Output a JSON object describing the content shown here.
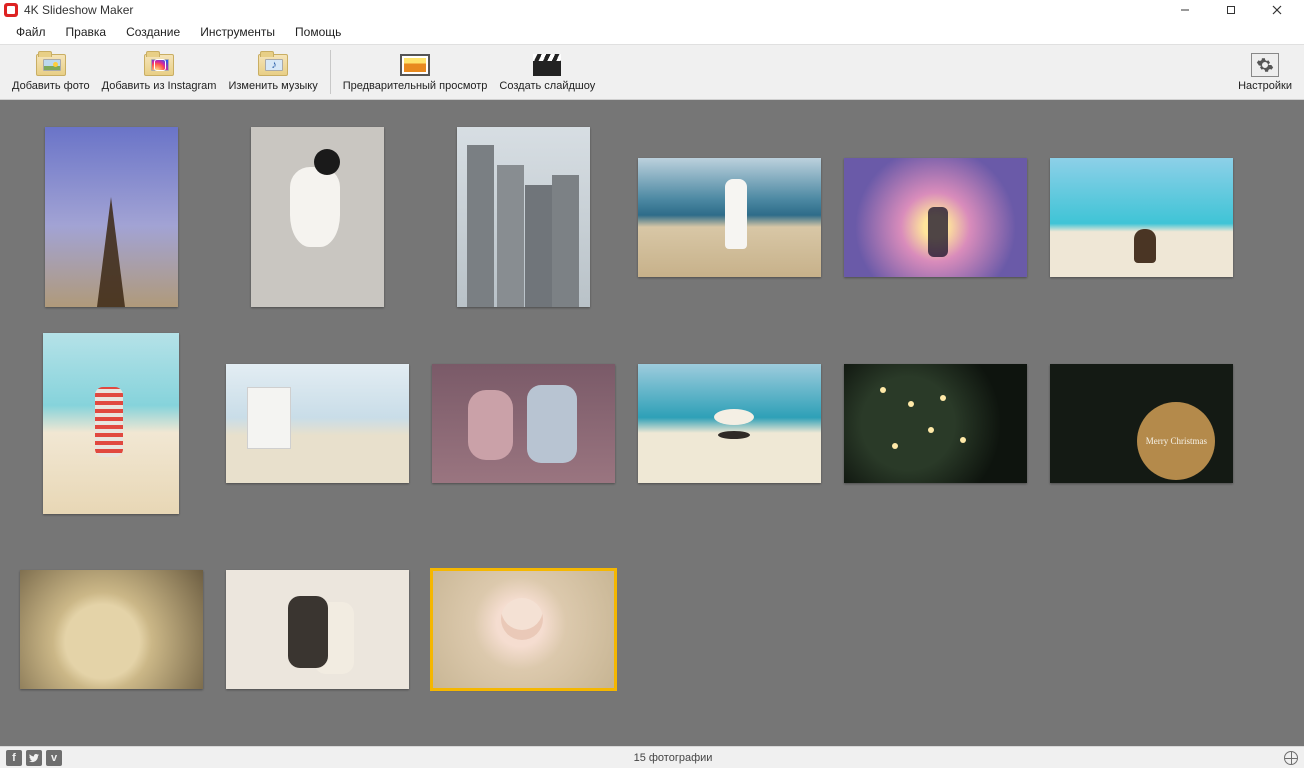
{
  "title": "4K Slideshow Maker",
  "menu": {
    "file": "Файл",
    "edit": "Правка",
    "create": "Создание",
    "tools": "Инструменты",
    "help": "Помощь"
  },
  "toolbar": {
    "add_photo": "Добавить фото",
    "add_instagram": "Добавить из Instagram",
    "change_music": "Изменить музыку",
    "preview": "Предварительный просмотр",
    "create_slideshow": "Создать слайдшоу",
    "settings": "Настройки"
  },
  "status": {
    "count_text": "15 фотографии"
  },
  "thumbs": [
    {
      "name": "eiffel-tower",
      "orientation": "portrait",
      "scene": "eiffel",
      "selected": false
    },
    {
      "name": "girl-sitting",
      "orientation": "portrait",
      "scene": "girl-sit",
      "selected": false
    },
    {
      "name": "city-skyline",
      "orientation": "portrait",
      "scene": "city",
      "selected": false
    },
    {
      "name": "beach-walking",
      "orientation": "landscape",
      "scene": "beach-walk",
      "selected": false
    },
    {
      "name": "sunset-heart",
      "orientation": "landscape",
      "scene": "sunset",
      "selected": false
    },
    {
      "name": "turquoise-beach",
      "orientation": "landscape",
      "scene": "turq-beach",
      "selected": false
    },
    {
      "name": "beach-kneeling",
      "orientation": "portrait2",
      "scene": "beach-kneel",
      "selected": false
    },
    {
      "name": "lifeguard-stand",
      "orientation": "landscape",
      "scene": "lifeguard",
      "selected": false
    },
    {
      "name": "family-kiss",
      "orientation": "landscape",
      "scene": "family",
      "selected": false
    },
    {
      "name": "hat-beach",
      "orientation": "landscape",
      "scene": "hat-beach",
      "selected": false
    },
    {
      "name": "christmas-tree",
      "orientation": "landscape",
      "scene": "xmas-dark",
      "selected": false
    },
    {
      "name": "merry-christmas",
      "orientation": "landscape",
      "scene": "merry",
      "selected": false
    },
    {
      "name": "wedding-rings",
      "orientation": "landscape",
      "scene": "rings",
      "selected": false
    },
    {
      "name": "wedding-couple",
      "orientation": "landscape",
      "scene": "wedding",
      "selected": false
    },
    {
      "name": "baby-blanket",
      "orientation": "landscape",
      "scene": "baby",
      "selected": true
    }
  ]
}
